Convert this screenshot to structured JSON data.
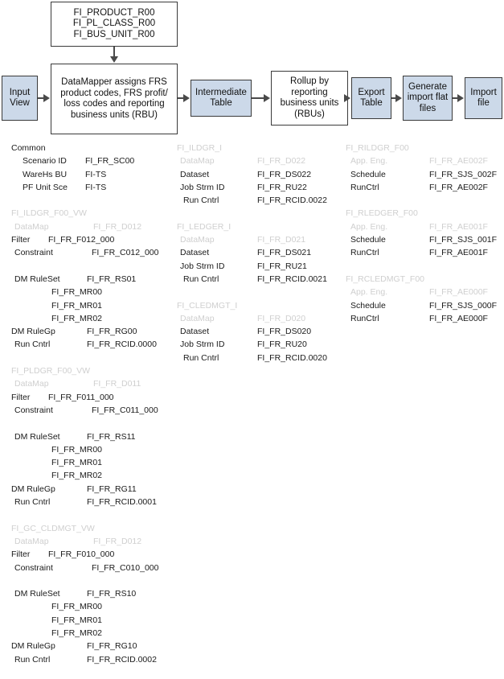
{
  "flow": {
    "nodes": [
      {
        "id": "top",
        "lines": [
          "FI_PRODUCT_R00",
          "FI_PL_CLASS_R00",
          "FI_BUS_UNIT_R00"
        ],
        "style": "white"
      },
      {
        "id": "input",
        "lines": [
          "Input",
          "View"
        ],
        "style": "blue"
      },
      {
        "id": "datamap",
        "lines": [
          "DataMapper assigns FRS",
          "product codes, FRS profit/",
          "loss codes and reporting",
          "business units (RBU)"
        ],
        "style": "white"
      },
      {
        "id": "intermediate",
        "lines": [
          "Intermediate",
          "Table"
        ],
        "style": "blue"
      },
      {
        "id": "rollup",
        "lines": [
          "Rollup by",
          "reporting",
          "business units",
          "(RBUs)"
        ],
        "style": "white"
      },
      {
        "id": "export",
        "lines": [
          "Export",
          "Table"
        ],
        "style": "blue"
      },
      {
        "id": "generate",
        "lines": [
          "Generate",
          "import flat",
          "files"
        ],
        "style": "blue"
      },
      {
        "id": "import",
        "lines": [
          "Import",
          "file"
        ],
        "style": "blue"
      }
    ]
  },
  "colors": {
    "node_fill_blue": "#ccd9e9",
    "node_fill_white": "#ffffff",
    "node_border": "#3a3a3a",
    "arrow": "#4a4a4a",
    "text": "#1a1a1a",
    "dim_text": "#cfcfcf"
  },
  "columns": {
    "left": {
      "groups": [
        {
          "header": "Common",
          "header_dim": false,
          "rows": [
            {
              "key": "Scenario ID",
              "value": "FI_FR_SC00",
              "dim": false,
              "indent": "i1"
            },
            {
              "key": "WareHs BU",
              "value": "FI-TS",
              "dim": false,
              "indent": "i1"
            },
            {
              "key": "PF Unit Sce",
              "value": "FI-TS",
              "dim": false,
              "indent": "i1"
            }
          ]
        },
        {
          "header": "FI_ILDGR_F00_VW",
          "header_dim": true,
          "rows": [
            {
              "key": "DataMap",
              "value": "FI_FR_D012",
              "dim": true,
              "indent": "dmap"
            },
            {
              "key": "Filter",
              "value": "FI_FR_F012_000",
              "dim": false,
              "indent": "filter"
            },
            {
              "key": "Constraint",
              "value": "FI_FR_C012_000",
              "dim": false,
              "indent": "constraint"
            },
            {
              "key": "",
              "value": "",
              "dim": false,
              "indent": "blankrow"
            },
            {
              "key": "DM RuleSet",
              "value": "FI_FR_RS01",
              "dim": false,
              "indent": "ruleset"
            },
            {
              "key": "",
              "value": "FI_FR_MR00",
              "dim": false,
              "indent": "i2"
            },
            {
              "key": "",
              "value": "FI_FR_MR01",
              "dim": false,
              "indent": "i2"
            },
            {
              "key": "",
              "value": "FI_FR_MR02",
              "dim": false,
              "indent": "i2"
            },
            {
              "key": "DM RuleGp",
              "value": "FI_FR_RG00",
              "dim": false,
              "indent": "rulegp"
            },
            {
              "key": "Run Cntrl",
              "value": "FI_FR_RCID.0000",
              "dim": false,
              "indent": "runcntrl"
            }
          ]
        },
        {
          "header": "FI_PLDGR_F00_VW",
          "header_dim": true,
          "rows": [
            {
              "key": "DataMap",
              "value": "FI_FR_D011",
              "dim": true,
              "indent": "dmap"
            },
            {
              "key": "Filter",
              "value": "FI_FR_F011_000",
              "dim": false,
              "indent": "filter"
            },
            {
              "key": "Constraint",
              "value": "FI_FR_C011_000",
              "dim": false,
              "indent": "constraint"
            },
            {
              "key": "",
              "value": "",
              "dim": false,
              "indent": "blankrow"
            },
            {
              "key": "DM RuleSet",
              "value": "FI_FR_RS11",
              "dim": false,
              "indent": "ruleset"
            },
            {
              "key": "",
              "value": "FI_FR_MR00",
              "dim": false,
              "indent": "i2"
            },
            {
              "key": "",
              "value": "FI_FR_MR01",
              "dim": false,
              "indent": "i2"
            },
            {
              "key": "",
              "value": "FI_FR_MR02",
              "dim": false,
              "indent": "i2"
            },
            {
              "key": "DM RuleGp",
              "value": "FI_FR_RG11",
              "dim": false,
              "indent": "rulegp"
            },
            {
              "key": "Run Cntrl",
              "value": "FI_FR_RCID.0001",
              "dim": false,
              "indent": "runcntrl"
            }
          ]
        },
        {
          "header": "FI_GC_CLDMGT_VW",
          "header_dim": true,
          "rows": [
            {
              "key": "DataMap",
              "value": "FI_FR_D012",
              "dim": true,
              "indent": "dmap"
            },
            {
              "key": "Filter",
              "value": "FI_FR_F010_000",
              "dim": false,
              "indent": "filter"
            },
            {
              "key": "Constraint",
              "value": "FI_FR_C010_000",
              "dim": false,
              "indent": "constraint"
            },
            {
              "key": "",
              "value": "",
              "dim": false,
              "indent": "blankrow"
            },
            {
              "key": "DM RuleSet",
              "value": "FI_FR_RS10",
              "dim": false,
              "indent": "ruleset"
            },
            {
              "key": "",
              "value": "FI_FR_MR00",
              "dim": false,
              "indent": "i2"
            },
            {
              "key": "",
              "value": "FI_FR_MR01",
              "dim": false,
              "indent": "i2"
            },
            {
              "key": "",
              "value": "FI_FR_MR02",
              "dim": false,
              "indent": "i2"
            },
            {
              "key": "DM RuleGp",
              "value": "FI_FR_RG10",
              "dim": false,
              "indent": "rulegp"
            },
            {
              "key": "Run Cntrl",
              "value": "FI_FR_RCID.0002",
              "dim": false,
              "indent": "runcntrl"
            }
          ]
        }
      ]
    },
    "mid": {
      "groups": [
        {
          "header": "FI_ILDGR_I",
          "header_dim": true,
          "rows": [
            {
              "key": "DataMap",
              "value": "FI_FR_D022",
              "dim": true,
              "indent": ""
            },
            {
              "key": "Dataset",
              "value": "FI_FR_DS022",
              "dim": false,
              "indent": ""
            },
            {
              "key": "Job Strm ID",
              "value": "FI_FR_RU22",
              "dim": false,
              "indent": ""
            },
            {
              "key": "Run Cntrl",
              "value": "FI_FR_RCID.0022",
              "dim": false,
              "indent": "runc"
            }
          ]
        },
        {
          "header": "FI_LEDGER_I",
          "header_dim": true,
          "rows": [
            {
              "key": "DataMap",
              "value": "FI_FR_D021",
              "dim": true,
              "indent": ""
            },
            {
              "key": "Dataset",
              "value": "FI_FR_DS021",
              "dim": false,
              "indent": ""
            },
            {
              "key": "Job Strm ID",
              "value": "FI_FR_RU21",
              "dim": false,
              "indent": ""
            },
            {
              "key": "Run Cntrl",
              "value": "FI_FR_RCID.0021",
              "dim": false,
              "indent": "runc"
            }
          ]
        },
        {
          "header": "FI_CLEDMGT_I",
          "header_dim": true,
          "rows": [
            {
              "key": "DataMap",
              "value": "FI_FR_D020",
              "dim": true,
              "indent": ""
            },
            {
              "key": "Dataset",
              "value": "FI_FR_DS020",
              "dim": false,
              "indent": ""
            },
            {
              "key": "Job Strm ID",
              "value": "FI_FR_RU20",
              "dim": false,
              "indent": ""
            },
            {
              "key": "Run Cntrl",
              "value": "FI_FR_RCID.0020",
              "dim": false,
              "indent": "runc"
            }
          ]
        }
      ]
    },
    "right": {
      "groups": [
        {
          "header": "FI_RILDGR_F00",
          "header_dim": true,
          "rows": [
            {
              "key": "App. Eng.",
              "value": "FI_FR_AE002F",
              "dim": true,
              "indent": ""
            },
            {
              "key": "Schedule",
              "value": "FI_FR_SJS_002F",
              "dim": false,
              "indent": ""
            },
            {
              "key": "RunCtrl",
              "value": "FI_FR_AE002F",
              "dim": false,
              "indent": ""
            }
          ]
        },
        {
          "header": "FI_RLEDGER_F00",
          "header_dim": true,
          "rows": [
            {
              "key": "App. Eng.",
              "value": "FI_FR_AE001F",
              "dim": true,
              "indent": ""
            },
            {
              "key": "Schedule",
              "value": "FI_FR_SJS_001F",
              "dim": false,
              "indent": ""
            },
            {
              "key": "RunCtrl",
              "value": "FI_FR_AE001F",
              "dim": false,
              "indent": ""
            }
          ]
        },
        {
          "header": "FI_RCLEDMGT_F00",
          "header_dim": true,
          "rows": [
            {
              "key": "App. Eng.",
              "value": "FI_FR_AE000F",
              "dim": true,
              "indent": ""
            },
            {
              "key": "Schedule",
              "value": "FI_FR_SJS_000F",
              "dim": false,
              "indent": ""
            },
            {
              "key": "RunCtrl",
              "value": "FI_FR_AE000F",
              "dim": false,
              "indent": ""
            }
          ]
        }
      ]
    }
  }
}
